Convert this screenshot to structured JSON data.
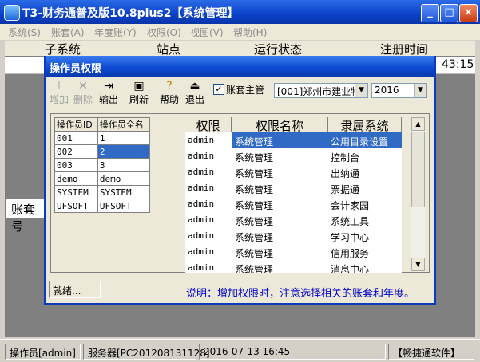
{
  "window": {
    "title": "T3-财务通普及版10.8plus2【系统管理】",
    "controls": [
      "_",
      "□",
      "×"
    ]
  },
  "menu": [
    "系统(S)",
    "账套(A)",
    "年度账(Y)",
    "权限(O)",
    "视图(V)",
    "帮助(H)"
  ],
  "main_grid": {
    "columns": [
      "子系统",
      "站点",
      "运行状态",
      "注册时间"
    ],
    "row_time": "43:15",
    "account_tab": "账套号"
  },
  "dialog": {
    "title": "操作员权限",
    "toolbar": {
      "add": "增加",
      "delete": "删除",
      "output": "输出",
      "refresh": "刷新",
      "help": "帮助",
      "exit": "退出"
    },
    "account_master_label": "账套主管",
    "account_master_checked": "✓",
    "account_combo": "[001]郑州市建业物",
    "year_combo": "2016",
    "operators": {
      "headers": [
        "操作员ID",
        "操作员全名"
      ],
      "rows": [
        [
          "001",
          "1"
        ],
        [
          "002",
          "2"
        ],
        [
          "003",
          "3"
        ],
        [
          "demo",
          "demo"
        ],
        [
          "SYSTEM",
          "SYSTEM"
        ],
        [
          "UFSOFT",
          "UFSOFT"
        ]
      ],
      "selected_index": 1
    },
    "permissions": {
      "headers": [
        "权限",
        "权限名称",
        "隶属系统"
      ],
      "rows": [
        [
          "admin",
          "系统管理",
          "公用目录设置"
        ],
        [
          "admin",
          "系统管理",
          "控制台"
        ],
        [
          "admin",
          "系统管理",
          "出纳通"
        ],
        [
          "admin",
          "系统管理",
          "票据通"
        ],
        [
          "admin",
          "系统管理",
          "会计家园"
        ],
        [
          "admin",
          "系统管理",
          "系统工具"
        ],
        [
          "admin",
          "系统管理",
          "学习中心"
        ],
        [
          "admin",
          "系统管理",
          "信用服务"
        ],
        [
          "admin",
          "系统管理",
          "消息中心"
        ]
      ]
    },
    "status": "就绪...",
    "note": "说明：增加权限时，注意选择相关的账套和年度。"
  },
  "statusbar": {
    "operator": "操作员[admin]",
    "server": "服务器[PC201208131128]",
    "datetime": "2016-07-13 16:45",
    "vendor": "【畅捷通软件】"
  },
  "colors": {
    "title_blue": "#0a40c8",
    "selection": "#316ac5",
    "note_blue": "#0000cc"
  }
}
